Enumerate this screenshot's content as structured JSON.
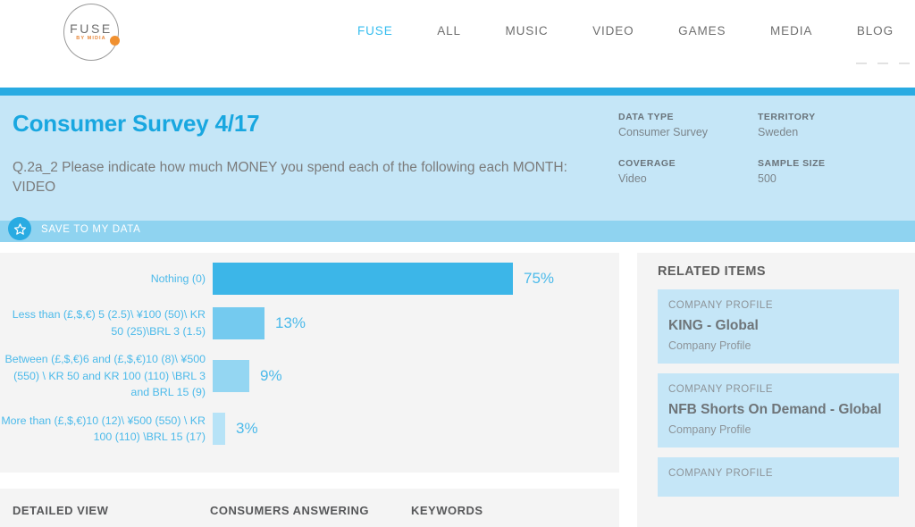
{
  "nav": {
    "logo": {
      "word": "FUSE",
      "subtitle": "BY MIDIA"
    },
    "items": [
      {
        "label": "FUSE",
        "active": true
      },
      {
        "label": "ALL",
        "active": false
      },
      {
        "label": "MUSIC",
        "active": false
      },
      {
        "label": "VIDEO",
        "active": false
      },
      {
        "label": "GAMES",
        "active": false
      },
      {
        "label": "MEDIA",
        "active": false
      },
      {
        "label": "BLOG",
        "active": false
      }
    ]
  },
  "hero": {
    "title": "Consumer Survey 4/17",
    "question": "Q.2a_2 Please indicate how much MONEY you spend each of the following each MONTH: VIDEO",
    "meta": [
      {
        "label": "DATA TYPE",
        "value": "Consumer Survey"
      },
      {
        "label": "TERRITORY",
        "value": "Sweden"
      },
      {
        "label": "COVERAGE",
        "value": "Video"
      },
      {
        "label": "SAMPLE SIZE",
        "value": "500"
      }
    ]
  },
  "savebar": {
    "label": "SAVE TO MY DATA",
    "icon": "star-icon"
  },
  "chart_data": {
    "type": "bar",
    "title": "Q.2a_2 Please indicate how much MONEY you spend each of the following each MONTH: VIDEO",
    "orientation": "horizontal",
    "xlabel": "",
    "ylabel": "",
    "xlim": [
      0,
      100
    ],
    "grid": false,
    "legend": "none",
    "unit": "%",
    "categories": [
      "Nothing (0)",
      "Less than (£,$,€) 5 (2.5)\\ ¥100 (50)\\ KR 50 (25)\\BRL 3 (1.5)",
      "Between (£,$,€)6 and (£,$,€)10 (8)\\ ¥500 (550) \\ KR 50 and KR 100 (110) \\BRL 3 and BRL 15 (9)",
      "More than (£,$,€)10 (12)\\ ¥500 (550) \\ KR 100 (110) \\BRL 15 (17)"
    ],
    "values": [
      75,
      13,
      9,
      3
    ],
    "value_labels": [
      "75%",
      "13%",
      "9%",
      "3%"
    ],
    "bar_colors": [
      "#3cb6e8",
      "#74caef",
      "#94d6f2",
      "#b7e3f7"
    ]
  },
  "related": {
    "title": "RELATED ITEMS",
    "items": [
      {
        "kicker": "COMPANY PROFILE",
        "title": "KING - Global",
        "subtitle": "Company Profile"
      },
      {
        "kicker": "COMPANY PROFILE",
        "title": "NFB Shorts On Demand - Global",
        "subtitle": "Company Profile"
      },
      {
        "kicker": "COMPANY PROFILE",
        "title": "",
        "subtitle": ""
      }
    ]
  },
  "tabs": [
    {
      "label": "DETAILED VIEW"
    },
    {
      "label": "CONSUMERS ANSWERING"
    },
    {
      "label": "KEYWORDS"
    }
  ]
}
